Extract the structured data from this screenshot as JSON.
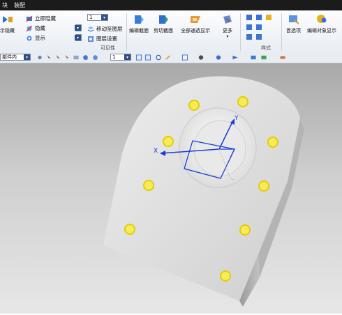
{
  "menu": {
    "item1": "块",
    "item2": "装配"
  },
  "ribbon": {
    "left_button_label": "示隐藏",
    "show_hide": {
      "item1": "立即隐藏",
      "item2": "隐藏",
      "item3": "显示"
    },
    "layer_value": "1",
    "move_to_layer": "移动至图层",
    "layer_settings": "图层设置",
    "visibility_group": "可见性",
    "edit_section": "编辑截面",
    "clip_section": "剪切截面",
    "show_all_passing": "全部通透显示",
    "more": "更多",
    "style_group": "样式",
    "preferences": "首选项",
    "edit_object_display": "编辑对象显示"
  },
  "toolbar2": {
    "filter_value": "部件内",
    "layer_value": "1"
  },
  "viewport": {
    "axis_x": "X",
    "axis_y": "Y",
    "part_color": "#d6d6d6",
    "hole_color": "#f3e11a"
  }
}
